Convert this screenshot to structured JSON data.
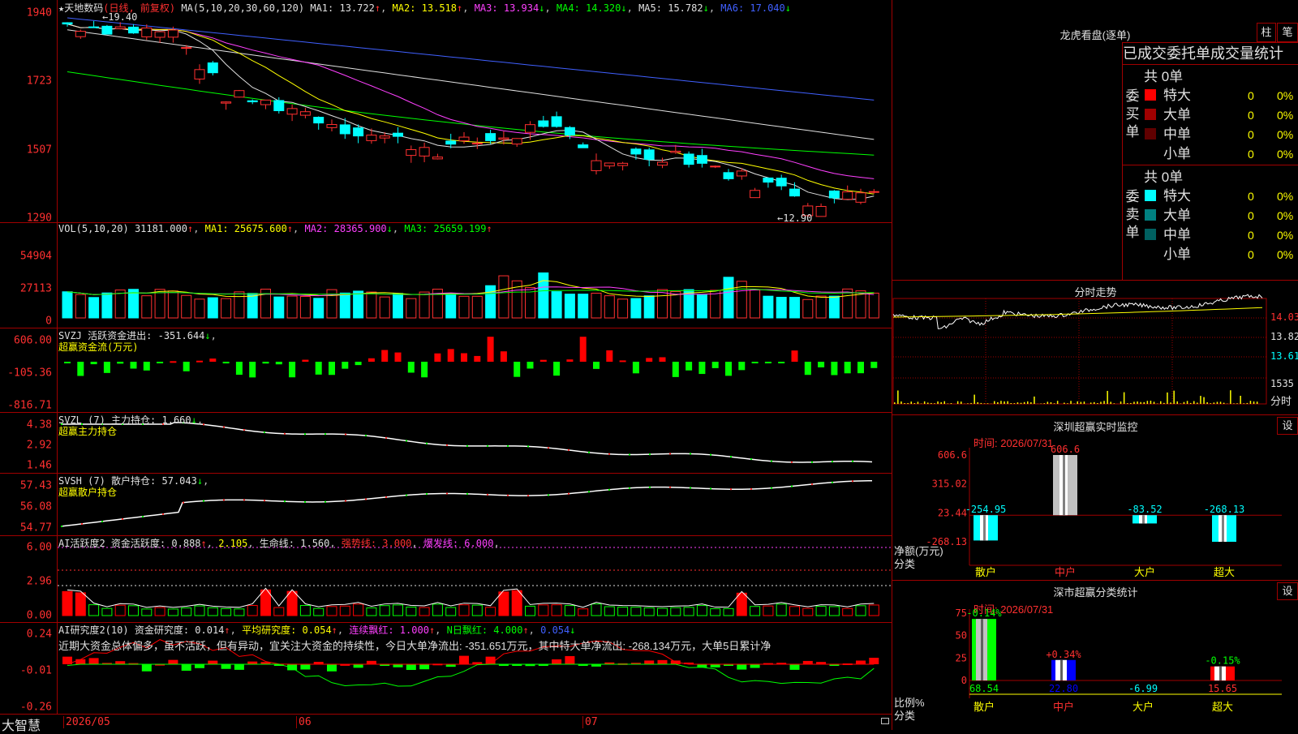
{
  "stock": {
    "name": "天地数码",
    "mode": "(日线, 前复权)",
    "star": "★",
    "high_label": "19.40",
    "low_label": "12.90",
    "hi_arrow": "←",
    "low_arrow": "←"
  },
  "price_panel": {
    "ma_label": "MA(5,10,20,30,60,120)",
    "ma": [
      {
        "name": "MA1",
        "value": "13.722",
        "arrow": "↑",
        "color": "#e0e0e0"
      },
      {
        "name": "MA2",
        "value": "13.518",
        "arrow": "↑",
        "color": "#ffff00"
      },
      {
        "name": "MA3",
        "value": "13.934",
        "arrow": "↓",
        "color": "#ff40ff"
      },
      {
        "name": "MA4",
        "value": "14.320",
        "arrow": "↓",
        "color": "#00ff00"
      },
      {
        "name": "MA5",
        "value": "15.782",
        "arrow": "↓",
        "color": "#e0e0e0"
      },
      {
        "name": "MA6",
        "value": "17.040",
        "arrow": "↓",
        "color": "#4060ff"
      }
    ],
    "y_ticks": [
      "1940",
      "1723",
      "1507",
      "1290"
    ]
  },
  "vol_panel": {
    "label": "VOL(5,10,20)",
    "value": "31181.000",
    "arrow": "↑",
    "ma": [
      {
        "name": "MA1",
        "value": "25675.600",
        "arrow": "↑",
        "color": "#ffff00"
      },
      {
        "name": "MA2",
        "value": "28365.900",
        "arrow": "↓",
        "color": "#ff40ff"
      },
      {
        "name": "MA3",
        "value": "25659.199",
        "arrow": "↑",
        "color": "#00ff00"
      }
    ],
    "y_ticks": [
      "54904",
      "27113",
      "0"
    ]
  },
  "svzj_panel": {
    "label": "SVZJ",
    "title": "活跃资金进出:",
    "value": "-351.644",
    "arrow": "↓",
    "sub": "超赢资金流(万元)",
    "y_ticks": [
      "606.00",
      "-105.36",
      "-816.71"
    ]
  },
  "svzl_panel": {
    "label": "SVZL (7)",
    "title": "主力持仓:",
    "value": "1.660",
    "arrow": "↓",
    "sub": "超赢主力持仓",
    "y_ticks": [
      "4.38",
      "2.92",
      "1.46"
    ]
  },
  "svsh_panel": {
    "label": "SVSH (7)",
    "title": "散户持仓:",
    "value": "57.043",
    "arrow": "↓",
    "sub": "超赢散户持仓",
    "y_ticks": [
      "57.43",
      "56.08",
      "54.77"
    ]
  },
  "ai_active_panel": {
    "label": "AI活跃度2",
    "title": "资金活跃度:",
    "value": "0.888",
    "arrow": "↑",
    "v2": "2.105",
    "life_label": "生命线:",
    "life": "1.560",
    "strong": "强势线: 3.000",
    "burst": "爆发线: 6.000",
    "y_ticks": [
      "6.00",
      "2.96",
      "0.00"
    ]
  },
  "ai_research_panel": {
    "label": "AI研究度2(10)",
    "title": "资金研究度:",
    "value": "0.014",
    "arrow": "↑",
    "avg": "平均研究度: 0.054",
    "avg_arrow": "↑",
    "cont": "连续飘红: 1.000",
    "cont_arrow": "↑",
    "nday": "N日飘红: 4.000",
    "nday_arrow": "↑",
    "last": "0.054",
    "last_arrow": "↓",
    "comment": "近期大资金总体偏多，虽不活跃，但有异动，宜关注大资金的持续性，今日大单净流出: -351.651万元，其中特大单净流出: -268.134万元，大单5日累计净",
    "y_ticks": [
      "0.24",
      "-0.01",
      "-0.26"
    ]
  },
  "x_axis": {
    "brand": "大智慧",
    "labels": [
      "2026/05",
      "06",
      "07"
    ]
  },
  "dragon": {
    "title": "龙虎看盘(逐单)",
    "btn_a": "柱",
    "btn_b": "笔",
    "header": "已成交委托单成交量统计",
    "buy": {
      "side": "委买单",
      "total": "共 0单",
      "rows": [
        {
          "label": "特大",
          "vol": "0",
          "pct": "0%",
          "color": "#ff0000"
        },
        {
          "label": "大单",
          "vol": "0",
          "pct": "0%",
          "color": "#a00000"
        },
        {
          "label": "中单",
          "vol": "0",
          "pct": "0%",
          "color": "#600000"
        },
        {
          "label": "小单",
          "vol": "0",
          "pct": "0%",
          "color": "#000000"
        }
      ]
    },
    "sell": {
      "side": "委卖单",
      "total": "共 0单",
      "rows": [
        {
          "label": "特大",
          "vol": "0",
          "pct": "0%",
          "color": "#00ffff"
        },
        {
          "label": "大单",
          "vol": "0",
          "pct": "0%",
          "color": "#008080"
        },
        {
          "label": "中单",
          "vol": "0",
          "pct": "0%",
          "color": "#006060"
        },
        {
          "label": "小单",
          "vol": "0",
          "pct": "0%",
          "color": "#000000"
        }
      ]
    }
  },
  "intraday": {
    "title": "分时走势",
    "prices": [
      "14.03",
      "13.82",
      "13.61"
    ],
    "vol": "1535",
    "vol_unit": "分时"
  },
  "sz_monitor": {
    "title": "深圳超赢实时监控",
    "btn": "设",
    "time": "时间: 2026/07/31",
    "y_ticks": [
      "606.6",
      "315.02",
      "23.44",
      "-268.13"
    ],
    "y_label": "净额(万元)",
    "x_label": "分类",
    "categories": [
      "散户",
      "中户",
      "大户",
      "超大"
    ],
    "values": [
      -254.95,
      606.6,
      -83.52,
      -268.13
    ],
    "value_labels": [
      "-254.95",
      "606.6",
      "-83.52",
      "-268.13"
    ]
  },
  "sz_stats": {
    "title": "深市超赢分类统计",
    "btn": "设",
    "time": "时间: 2026/07/31",
    "y_ticks": [
      "75",
      "50",
      "25",
      "0"
    ],
    "y_label": "比例%",
    "x_label": "分类",
    "categories": [
      "散户",
      "中户",
      "大户",
      "超大"
    ],
    "values": [
      68.54,
      22.8,
      -6.99,
      15.65
    ],
    "value_labels": [
      "68.54",
      "22.80",
      "-6.99",
      "15.65"
    ],
    "changes": [
      "-0.14%",
      "+0.34%",
      "",
      "-0.15%"
    ]
  }
}
